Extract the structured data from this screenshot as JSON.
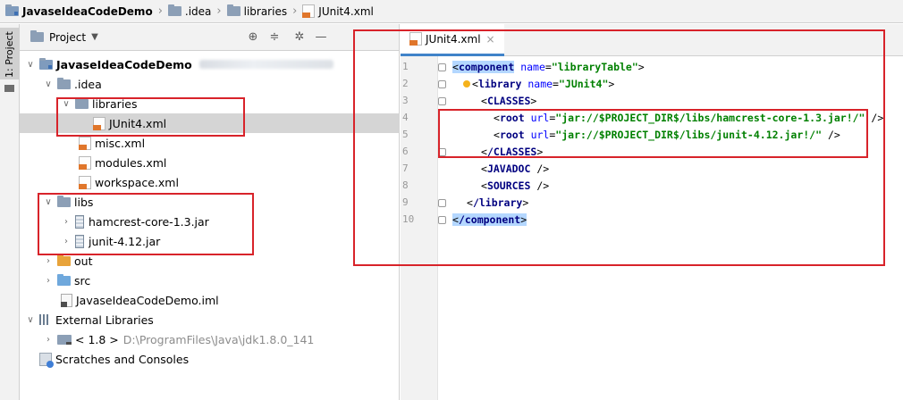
{
  "breadcrumb": {
    "items": [
      "JavaseIdeaCodeDemo",
      ".idea",
      "libraries",
      "JUnit4.xml"
    ]
  },
  "side_strip": {
    "project_tab": "1: Project"
  },
  "project_panel": {
    "title": "Project",
    "tree": [
      {
        "label": "JavaseIdeaCodeDemo",
        "kind": "module",
        "arrow": "expanded"
      },
      {
        "label": ".idea",
        "kind": "folder",
        "arrow": "expanded"
      },
      {
        "label": "libraries",
        "kind": "folder",
        "arrow": "expanded"
      },
      {
        "label": "JUnit4.xml",
        "kind": "xml",
        "arrow": "none",
        "selected": true
      },
      {
        "label": "misc.xml",
        "kind": "xml",
        "arrow": "none"
      },
      {
        "label": "modules.xml",
        "kind": "xml",
        "arrow": "none"
      },
      {
        "label": "workspace.xml",
        "kind": "xml",
        "arrow": "none"
      },
      {
        "label": "libs",
        "kind": "folder",
        "arrow": "expanded"
      },
      {
        "label": "hamcrest-core-1.3.jar",
        "kind": "jar",
        "arrow": "collapsed"
      },
      {
        "label": "junit-4.12.jar",
        "kind": "jar",
        "arrow": "collapsed"
      },
      {
        "label": "out",
        "kind": "folder-orange",
        "arrow": "collapsed"
      },
      {
        "label": "src",
        "kind": "folder-blue",
        "arrow": "collapsed"
      },
      {
        "label": "JavaseIdeaCodeDemo.iml",
        "kind": "iml",
        "arrow": "none"
      },
      {
        "label": "External Libraries",
        "kind": "libs",
        "arrow": "expanded"
      },
      {
        "label": "< 1.8 >",
        "suffix": "D:\\ProgramFiles\\Java\\jdk1.8.0_141",
        "kind": "sdk",
        "arrow": "collapsed"
      },
      {
        "label": "Scratches and Consoles",
        "kind": "scratch",
        "arrow": "none"
      }
    ]
  },
  "editor": {
    "tab_label": "JUnit4.xml",
    "line_numbers": [
      "1",
      "2",
      "3",
      "4",
      "5",
      "6",
      "7",
      "8",
      "9",
      "10"
    ],
    "lines": [
      {
        "tag": "component",
        "attr": "name",
        "value": "\"libraryTable\""
      },
      {
        "tag": "library",
        "attr": "name",
        "value": "\"JUnit4\""
      },
      {
        "tag": "CLASSES"
      },
      {
        "tag": "root",
        "attr": "url",
        "value": "\"jar://$PROJECT_DIR$/libs/hamcrest-core-1.3.jar!/\""
      },
      {
        "tag": "root",
        "attr": "url",
        "value": "\"jar://$PROJECT_DIR$/libs/junit-4.12.jar!/\""
      },
      {
        "tag": "/CLASSES"
      },
      {
        "tag": "JAVADOC"
      },
      {
        "tag": "SOURCES"
      },
      {
        "tag": "/library"
      },
      {
        "tag": "/component"
      }
    ]
  },
  "colors": {
    "annotation_box": "#d8232a",
    "selection": "#d5d5d5",
    "tag": "#000080",
    "attribute": "#0000ff",
    "string": "#008000"
  }
}
